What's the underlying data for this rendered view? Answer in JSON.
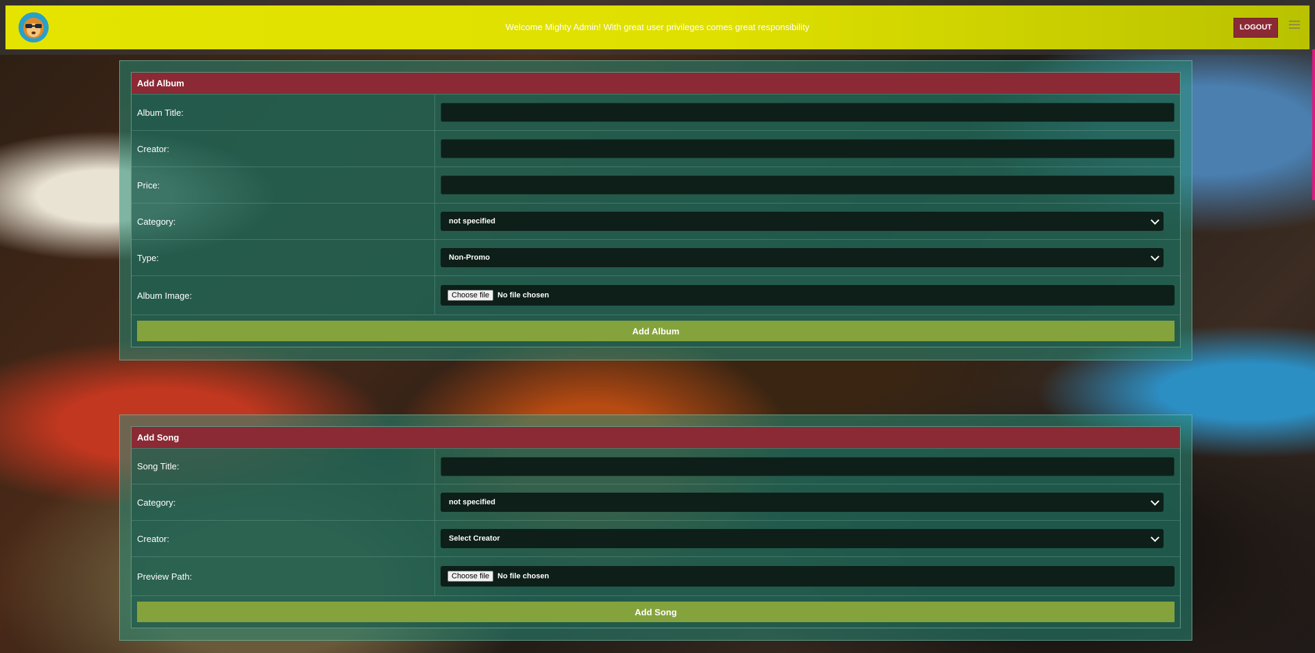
{
  "header": {
    "welcome_text": "Welcome Mighty Admin! With great user privileges comes great responsibility",
    "logout_label": "LOGOUT"
  },
  "album_form": {
    "title": "Add Album",
    "fields": {
      "album_title_label": "Album Title:",
      "creator_label": "Creator:",
      "price_label": "Price:",
      "category_label": "Category:",
      "category_value": "not specified",
      "type_label": "Type:",
      "type_value": "Non-Promo",
      "image_label": "Album Image:",
      "file_button": "Choose file",
      "file_status": "No file chosen"
    },
    "submit_label": "Add Album"
  },
  "song_form": {
    "title": "Add Song",
    "fields": {
      "song_title_label": "Song Title:",
      "category_label": "Category:",
      "category_value": "not specified",
      "creator_label": "Creator:",
      "creator_value": "Select Creator",
      "preview_label": "Preview Path:",
      "file_button": "Choose file",
      "file_status": "No file chosen"
    },
    "submit_label": "Add Song"
  },
  "colors": {
    "header_bg": "#e4e400",
    "panel_header": "#8b2a35",
    "submit_button": "#85a33c",
    "scroll_accent": "#e6157f"
  },
  "icons": [
    "lion-mascot-logo-icon",
    "hamburger-menu-icon",
    "chevron-down-icon"
  ]
}
